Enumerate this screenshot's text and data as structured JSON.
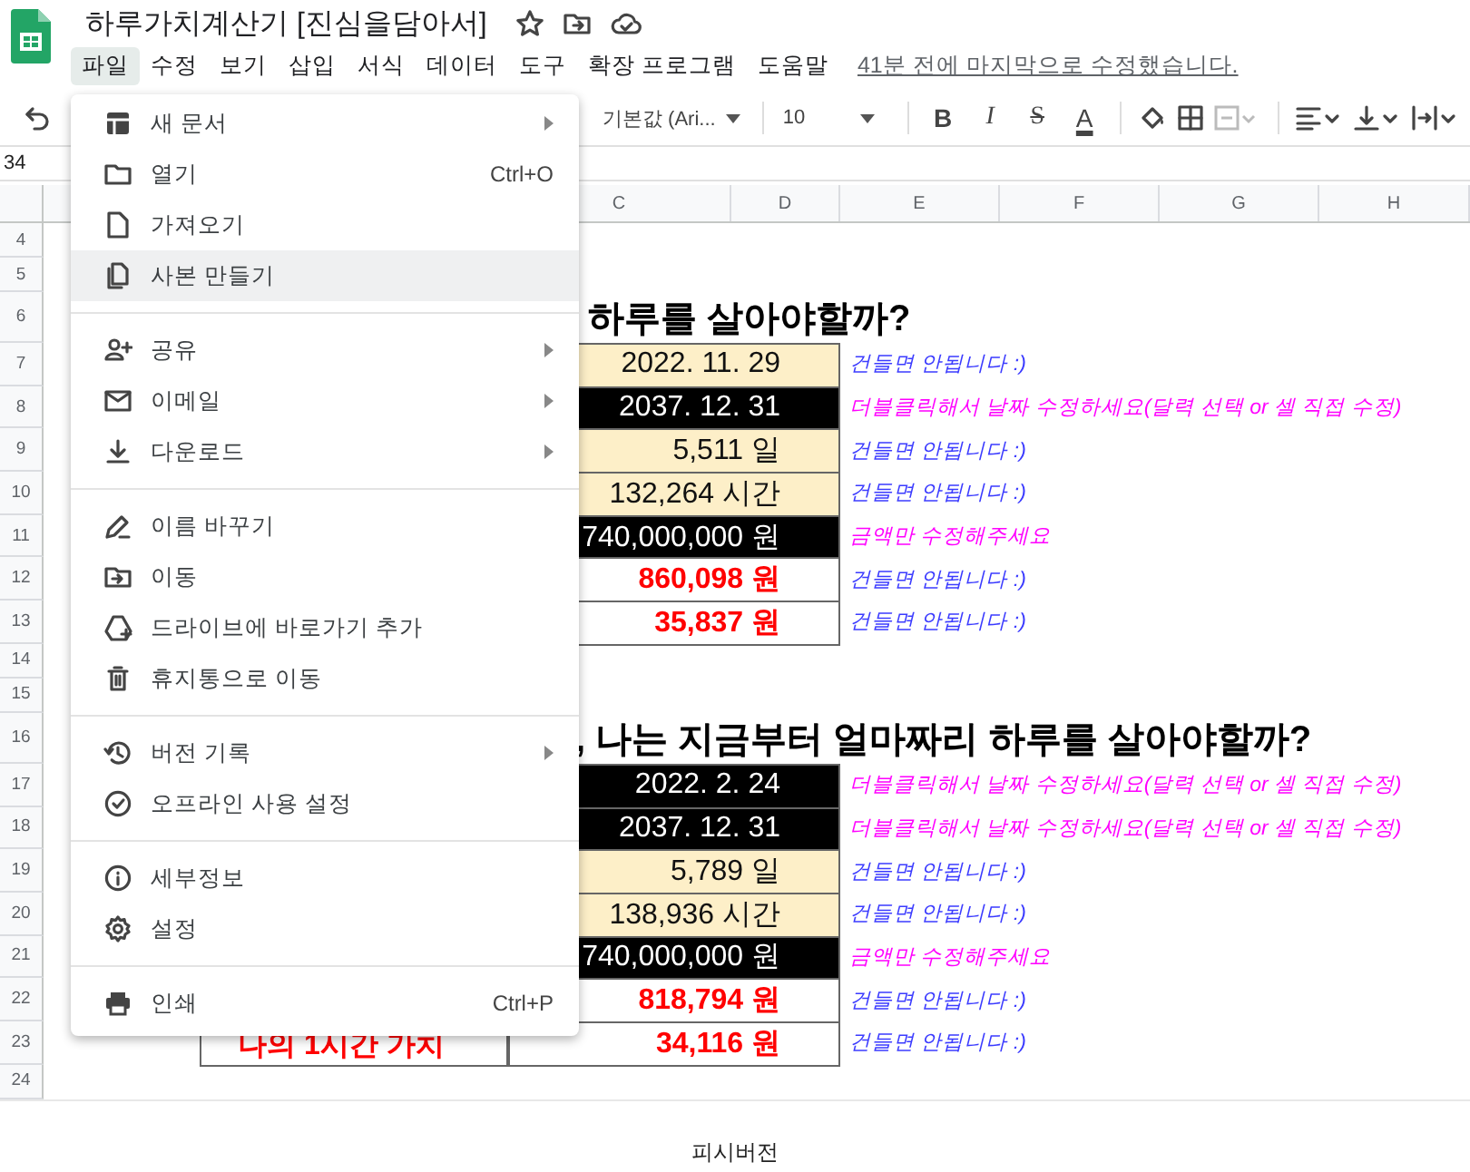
{
  "document": {
    "title": "하루가치계산기 [진심을담아서]"
  },
  "menu_bar": {
    "items": [
      {
        "label": "파일",
        "selected": true
      },
      {
        "label": "수정",
        "selected": false
      },
      {
        "label": "보기",
        "selected": false
      },
      {
        "label": "삽입",
        "selected": false
      },
      {
        "label": "서식",
        "selected": false
      },
      {
        "label": "데이터",
        "selected": false
      },
      {
        "label": "도구",
        "selected": false
      },
      {
        "label": "확장 프로그램",
        "selected": false
      },
      {
        "label": "도움말",
        "selected": false
      }
    ],
    "last_edit": "41분 전에 마지막으로 수정했습니다."
  },
  "toolbar": {
    "font": "기본값 (Ari...",
    "font_size": "10",
    "format_buttons": [
      "B",
      "I",
      "S",
      "A"
    ]
  },
  "name_box": "34",
  "columns": [
    "C",
    "D",
    "E",
    "F",
    "G",
    "H"
  ],
  "rows": [
    {
      "number": "4"
    },
    {
      "number": "5"
    },
    {
      "number": "6",
      "heading": "하루를 살아야할까?"
    },
    {
      "number": "7",
      "value": {
        "text": "2022. 11. 29",
        "kind": "computed"
      },
      "note": {
        "text": "건들면 안됩니다 :)",
        "color": "#3b3bff"
      }
    },
    {
      "number": "8",
      "value": {
        "text": "2037. 12. 31",
        "kind": "input"
      },
      "note": {
        "text": "더블클릭해서 날짜 수정하세요(달력 선택 or 셀 직접 수정)",
        "color": "#ff00ff"
      }
    },
    {
      "number": "9",
      "value": {
        "text": "5,511 일",
        "kind": "computed"
      },
      "note": {
        "text": "건들면 안됩니다 :)",
        "color": "#3b3bff"
      }
    },
    {
      "number": "10",
      "value": {
        "text": "132,264 시간",
        "kind": "computed"
      },
      "note": {
        "text": "건들면 안됩니다 :)",
        "color": "#3b3bff"
      }
    },
    {
      "number": "11",
      "value": {
        "text": "740,000,000 원",
        "kind": "input"
      },
      "note": {
        "text": "금액만 수정해주세요",
        "color": "#ff00ff"
      }
    },
    {
      "number": "12",
      "value": {
        "text": "860,098 원",
        "kind": "result"
      },
      "note": {
        "text": "건들면 안됩니다 :)",
        "color": "#3b3bff"
      }
    },
    {
      "number": "13",
      "value": {
        "text": "35,837 원",
        "kind": "result"
      },
      "note": {
        "text": "건들면 안됩니다 :)",
        "color": "#3b3bff"
      }
    },
    {
      "number": "14"
    },
    {
      "number": "15"
    },
    {
      "number": "16",
      "heading": ", 나는 지금부터 얼마짜리 하루를 살아야할까?"
    },
    {
      "number": "17",
      "value": {
        "text": "2022. 2. 24",
        "kind": "input"
      },
      "note": {
        "text": "더블클릭해서 날짜 수정하세요(달력 선택 or 셀 직접 수정)",
        "color": "#ff00ff"
      }
    },
    {
      "number": "18",
      "value": {
        "text": "2037. 12. 31",
        "kind": "input"
      },
      "note": {
        "text": "더블클릭해서 날짜 수정하세요(달력 선택 or 셀 직접 수정)",
        "color": "#ff00ff"
      }
    },
    {
      "number": "19",
      "value": {
        "text": "5,789 일",
        "kind": "computed"
      },
      "note": {
        "text": "건들면 안됩니다 :)",
        "color": "#3b3bff"
      }
    },
    {
      "number": "20",
      "value": {
        "text": "138,936 시간",
        "kind": "computed"
      },
      "note": {
        "text": "건들면 안됩니다 :)",
        "color": "#3b3bff"
      }
    },
    {
      "number": "21",
      "value": {
        "text": "740,000,000 원",
        "kind": "input"
      },
      "note": {
        "text": "금액만 수정해주세요",
        "color": "#ff00ff"
      }
    },
    {
      "number": "22",
      "value": {
        "text": "818,794 원",
        "kind": "result"
      },
      "note": {
        "text": "건들면 안됩니다 :)",
        "color": "#3b3bff"
      }
    },
    {
      "number": "23",
      "label": "나의 1시간 가치",
      "value": {
        "text": "34,116 원",
        "kind": "result"
      },
      "note": {
        "text": "건들면 안됩니다 :)",
        "color": "#3b3bff"
      }
    },
    {
      "number": "24"
    }
  ],
  "file_menu": {
    "sections": [
      {
        "items": [
          {
            "label": "새 문서",
            "submenu": true,
            "selected": false
          },
          {
            "label": "열기",
            "shortcut": "Ctrl+O",
            "submenu": false,
            "selected": false
          },
          {
            "label": "가져오기",
            "submenu": false,
            "selected": false
          },
          {
            "label": "사본 만들기",
            "submenu": false,
            "selected": true
          }
        ]
      },
      {
        "items": [
          {
            "label": "공유",
            "submenu": true,
            "selected": false
          },
          {
            "label": "이메일",
            "submenu": true,
            "selected": false
          },
          {
            "label": "다운로드",
            "submenu": true,
            "selected": false
          }
        ]
      },
      {
        "items": [
          {
            "label": "이름 바꾸기",
            "submenu": false,
            "selected": false
          },
          {
            "label": "이동",
            "submenu": false,
            "selected": false
          },
          {
            "label": "드라이브에 바로가기 추가",
            "submenu": false,
            "selected": false
          },
          {
            "label": "휴지통으로 이동",
            "submenu": false,
            "selected": false
          }
        ]
      },
      {
        "items": [
          {
            "label": "버전 기록",
            "submenu": true,
            "selected": false
          },
          {
            "label": "오프라인 사용 설정",
            "submenu": false,
            "selected": false
          }
        ]
      },
      {
        "items": [
          {
            "label": "세부정보",
            "submenu": false,
            "selected": false
          },
          {
            "label": "설정",
            "submenu": false,
            "selected": false
          }
        ]
      },
      {
        "items": [
          {
            "label": "인쇄",
            "shortcut": "Ctrl+P",
            "submenu": false,
            "selected": false
          }
        ]
      }
    ]
  },
  "footer": "피시버전"
}
